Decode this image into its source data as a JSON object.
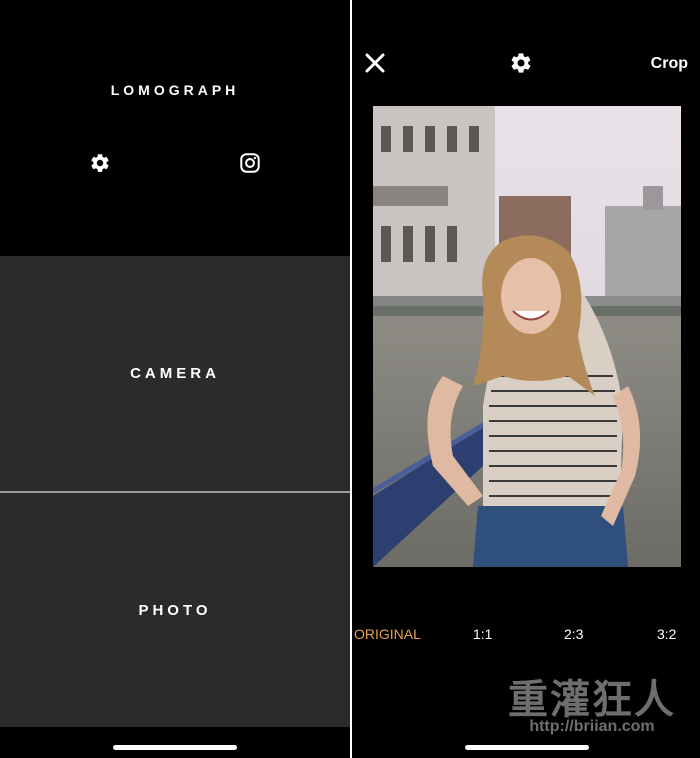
{
  "left": {
    "brand": "LOMOGRAPH",
    "icons": {
      "settings": "gear-icon",
      "instagram": "instagram-icon"
    },
    "camera_label": "CAMERA",
    "photo_label": "PHOTO"
  },
  "right": {
    "icons": {
      "close": "close-icon",
      "settings": "gear-icon"
    },
    "title": "Crop",
    "ratios": [
      "ORIGINAL",
      "1:1",
      "2:3",
      "3:2"
    ],
    "selected_ratio": "ORIGINAL",
    "watermark": {
      "big": "重灌狂人",
      "small": "http://briian.com"
    }
  },
  "colors": {
    "background": "#000000",
    "block": "#2b2b2b",
    "accent": "#e2a24a"
  }
}
